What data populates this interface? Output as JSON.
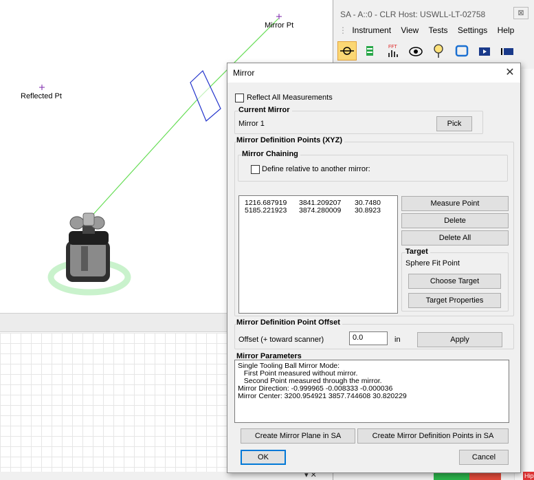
{
  "viewport": {
    "mirror_pt_label": "Mirror Pt",
    "reflected_pt_label": "Reflected Pt"
  },
  "sa_window": {
    "title": "SA - A::0 - CLR Host: USWLL-LT-02758",
    "close_glyph": "⊠",
    "menu": [
      "Instrument",
      "View",
      "Tests",
      "Settings",
      "Help"
    ],
    "toolbar_icons": [
      "target-crosshair-icon",
      "instrument-icon",
      "fft-icon",
      "eye-icon",
      "probe-icon",
      "refresh-icon",
      "video-icon",
      "panel-icon"
    ],
    "fft_label": "FFT"
  },
  "dialog": {
    "title": "Mirror",
    "close_glyph": "✕",
    "reflect_all_label": "Reflect All Measurements",
    "current_mirror_title": "Current Mirror",
    "current_mirror_value": "Mirror 1",
    "pick_label": "Pick",
    "def_points_title": "Mirror Definition Points (XYZ)",
    "chaining_title": "Mirror Chaining",
    "define_relative_label": "Define relative to another mirror:",
    "points": [
      [
        "1216.687919",
        "3841.209207",
        "30.7480"
      ],
      [
        "5185.221923",
        "3874.280009",
        "30.8923"
      ]
    ],
    "measure_point_label": "Measure Point",
    "delete_label": "Delete",
    "delete_all_label": "Delete All",
    "target_title": "Target",
    "target_value": "Sphere Fit Point",
    "choose_target_label": "Choose Target",
    "target_properties_label": "Target Properties",
    "offset_title": "Mirror Definition Point Offset",
    "offset_label": "Offset (+ toward scanner)",
    "offset_value": "0.0",
    "offset_unit": "in",
    "apply_label": "Apply",
    "params_title": "Mirror Parameters",
    "params_lines": [
      "Single Tooling Ball Mirror Mode:",
      "   First Point measured without mirror.",
      "   Second Point measured through the mirror.",
      "Mirror Direction: -0.999965 -0.008333 -0.000036",
      "Mirror Center: 3200.954921 3857.744608 30.820229"
    ],
    "create_plane_label": "Create Mirror Plane in SA",
    "create_points_label": "Create Mirror Definition Points in SA",
    "ok_label": "OK",
    "cancel_label": "Cancel"
  },
  "status_bar": {
    "chips": [
      "Hip-T"
    ]
  },
  "colors": {
    "beam": "#66dd55",
    "mirror_outline": "#2233cc",
    "point_marker": "#7a22aa",
    "toolbar_active": "#fbd774",
    "dialog_bg": "#f0f0f0",
    "ok_border": "#0078d7"
  }
}
